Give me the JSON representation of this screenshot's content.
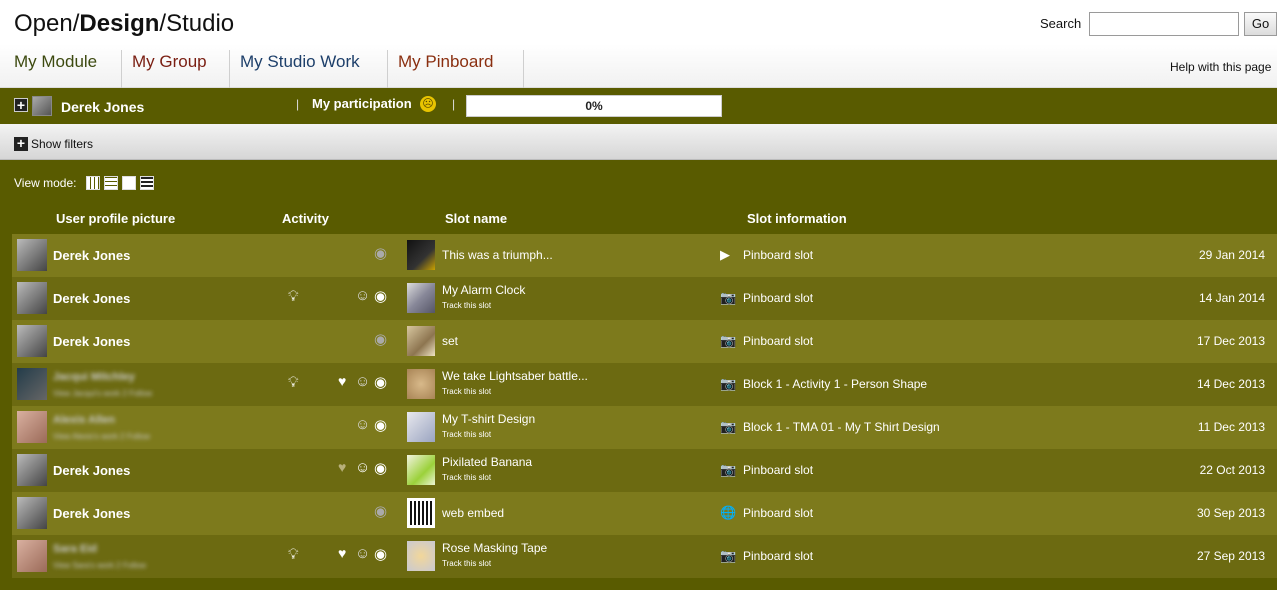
{
  "header": {
    "brand_part1": "Open/",
    "brand_part2": "Design",
    "brand_part3": "/Studio",
    "search_label": "Search",
    "search_value": "",
    "go_label": "Go"
  },
  "tabs": [
    {
      "label": "My Module"
    },
    {
      "label": "My Group"
    },
    {
      "label": "My Studio Work"
    },
    {
      "label": "My Pinboard"
    }
  ],
  "help_label": "Help with this page",
  "participation": {
    "user_name": "Derek Jones",
    "label": "My participation",
    "percent_text": "0%",
    "percent_value": 0
  },
  "filters": {
    "label": "Show filters"
  },
  "view_mode": {
    "label": "View mode:"
  },
  "columns": {
    "profile": "User profile picture",
    "activity": "Activity",
    "slot_name": "Slot name",
    "slot_info": "Slot information"
  },
  "rows": [
    {
      "user": "Derek Jones",
      "slot": "This was a triumph...",
      "track": "",
      "info": "Pinboard slot",
      "info_icon": "▶",
      "date": "29 Jan 2014"
    },
    {
      "user": "Derek Jones",
      "slot": "My Alarm Clock",
      "track": "Track this slot",
      "info": "Pinboard slot",
      "info_icon": "📷",
      "date": "14 Jan 2014"
    },
    {
      "user": "Derek Jones",
      "slot": "set",
      "track": "",
      "info": "Pinboard slot",
      "info_icon": "📷",
      "date": "17 Dec 2013"
    },
    {
      "user": "Jacqui Mitchley",
      "sub": "View Jacqui's work 2 Follow",
      "slot": "We take Lightsaber battle...",
      "track": "Track this slot",
      "info": "Block 1 - Activity 1 - Person Shape",
      "info_icon": "📷",
      "date": "14 Dec 2013"
    },
    {
      "user": "Alexis Allen",
      "sub": "View Alexis's work 2 Follow",
      "slot": "My T-shirt Design",
      "track": "Track this slot",
      "info": "Block 1 - TMA 01 - My T Shirt Design",
      "info_icon": "📷",
      "date": "11 Dec 2013"
    },
    {
      "user": "Derek Jones",
      "slot": "Pixilated Banana",
      "track": "Track this slot",
      "info": "Pinboard slot",
      "info_icon": "📷",
      "date": "22 Oct 2013"
    },
    {
      "user": "Derek Jones",
      "slot": "web embed",
      "track": "",
      "info": "Pinboard slot",
      "info_icon": "🌐",
      "date": "30 Sep 2013"
    },
    {
      "user": "Sara Eid",
      "sub": "View Sara's work 2 Follow",
      "slot": "Rose Masking Tape",
      "track": "Track this slot",
      "info": "Pinboard slot",
      "info_icon": "📷",
      "date": "27 Sep 2013"
    }
  ],
  "colors": {
    "olive_dark": "#595b00",
    "row_light": "#7d7a1c",
    "row_dark": "#6c6a11"
  }
}
